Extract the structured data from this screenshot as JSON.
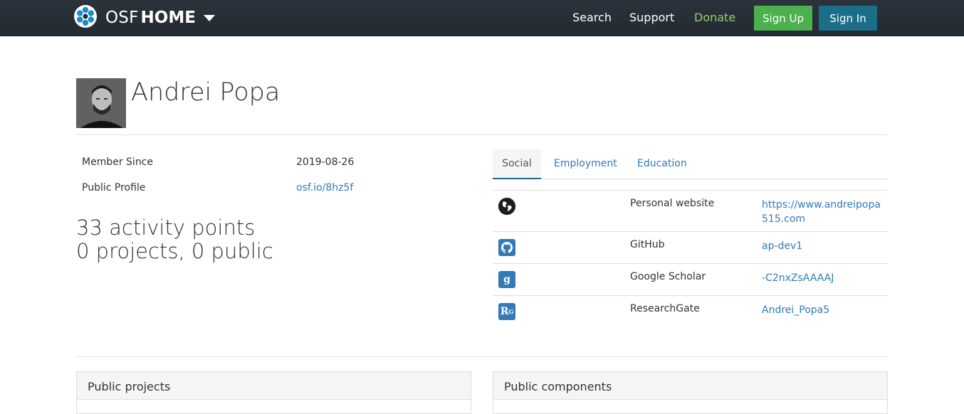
{
  "navbar": {
    "brand_osf": "OSF",
    "brand_home": "HOME",
    "links": {
      "search": "Search",
      "support": "Support",
      "donate": "Donate"
    },
    "sign_up": "Sign Up",
    "sign_in": "Sign In"
  },
  "profile": {
    "name": "Andrei Popa",
    "member_since_label": "Member Since",
    "member_since_value": "2019-08-26",
    "public_profile_label": "Public Profile",
    "public_profile_value": "osf.io/8hz5f",
    "activity_points": "33 activity points",
    "projects": "0 projects, 0 public"
  },
  "tabs": [
    {
      "label": "Social"
    },
    {
      "label": "Employment"
    },
    {
      "label": "Education"
    }
  ],
  "social": [
    {
      "icon": "globe-icon",
      "name": "Personal website",
      "value": "https://www.andreipopa515.com"
    },
    {
      "icon": "github-icon",
      "name": "GitHub",
      "value": "ap-dev1"
    },
    {
      "icon": "google-scholar-icon",
      "name": "Google Scholar",
      "value": "-C2nxZsAAAAJ"
    },
    {
      "icon": "researchgate-icon",
      "name": "ResearchGate",
      "value": "Andrei_Popa5"
    }
  ],
  "panels": {
    "public_projects": "Public projects",
    "public_components": "Public components"
  },
  "colors": {
    "navbar": "#232a32",
    "sign_up": "#4cb04d",
    "sign_in": "#1b6e87",
    "donate": "#8fd36d",
    "link": "#337ab7"
  }
}
